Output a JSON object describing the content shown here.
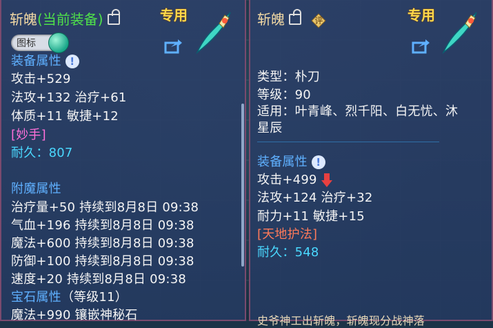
{
  "left_panel": {
    "item_name": "斩魄",
    "equipped_tag": "(当前装备)",
    "exclusive_label": "专用",
    "icon_toggle_label": "图标",
    "equip_attr_header": "装备属性",
    "stats": [
      "攻击+529",
      "法攻+132 治疗+61",
      "体质+11 敏捷+12"
    ],
    "special_skill": "[妙手]",
    "durability": "耐久：807",
    "enchant_header": "附魔属性",
    "enchants": [
      "治疗量+50 持续到8月8日 09:38",
      "气血+196 持续到8月8日 09:38",
      "魔法+600 持续到8月8日 09:38",
      "防御+100 持续到8月8日 09:38",
      "速度+20 持续到8月8日 09:38"
    ],
    "gem_header": "宝石属性",
    "gem_level": "（等级11）",
    "gem_line": "魔法+990 镶嵌神秘石"
  },
  "right_panel": {
    "item_name": "斩魄",
    "appraise_label": "评",
    "exclusive_label": "专用",
    "type": "类型：朴刀",
    "level": "等级：90",
    "applicable_line1": "适用：叶青峰、烈千阳、白无忧、沐",
    "applicable_line2": "星辰",
    "equip_attr_header": "装备属性",
    "stats": [
      "攻击+499",
      "法攻+124 治疗+32",
      "耐力+11 敏捷+15"
    ],
    "special_skill": "[天地护法]",
    "durability_label": "耐久：",
    "durability_value": "548",
    "footer_partial": "史爷神工出斩魄，斩魄现分战神落"
  },
  "colors": {
    "accent_blue": "#5fb0ff",
    "exclusive_gold": "#ffd84a",
    "equipped_green": "#4fe04a",
    "skill_pink": "#ff6fd8",
    "skill_red": "#ff7a5a",
    "durability_cyan": "#4ad8ff"
  },
  "icons": [
    "lock-icon",
    "share-icon",
    "weapon-icon",
    "info-icon",
    "down-arrow-icon",
    "appraise-icon"
  ]
}
